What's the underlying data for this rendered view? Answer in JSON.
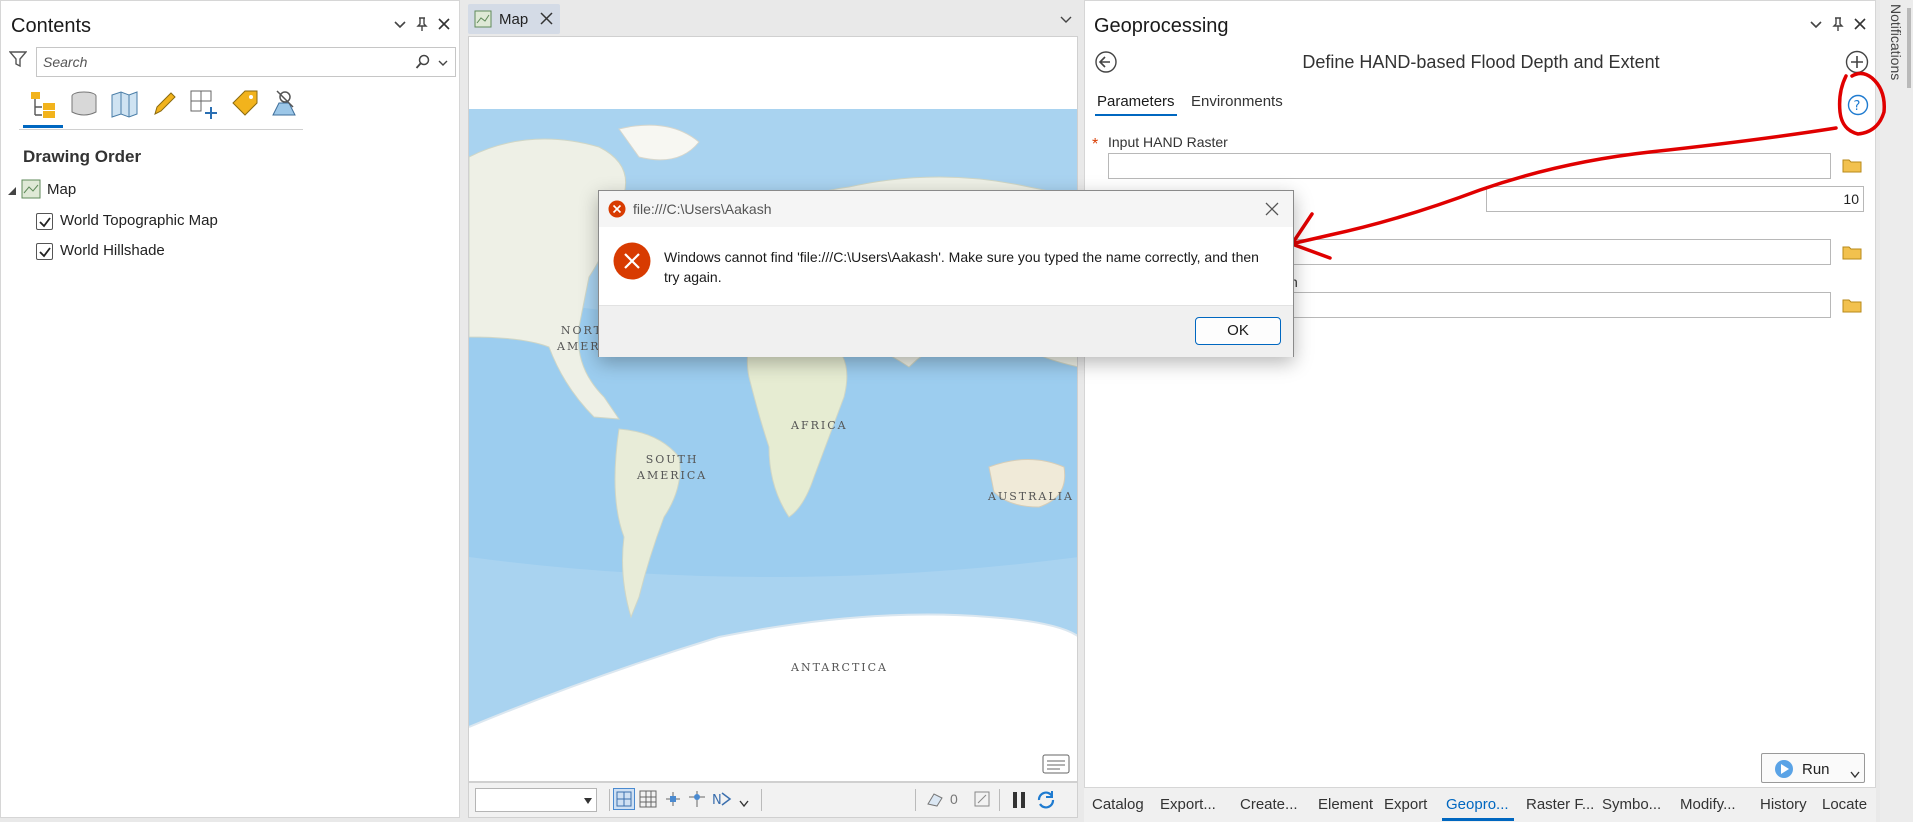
{
  "contents": {
    "title": "Contents",
    "search_placeholder": "Search",
    "section": "Drawing Order",
    "map_node": "Map",
    "layers": [
      {
        "label": "World Topographic Map",
        "checked": true
      },
      {
        "label": "World Hillshade",
        "checked": true
      }
    ]
  },
  "map_view": {
    "tab_label": "Map",
    "labels": {
      "north_america": [
        "NORT",
        "AMERI"
      ],
      "south_america": [
        "SOUTH",
        "AMERICA"
      ],
      "africa": "AFRICA",
      "australia": "AUSTRALIA",
      "antarctica": "ANTARCTICA"
    },
    "selection_count": "0"
  },
  "geoprocessing": {
    "title": "Geoprocessing",
    "tool_title": "Define HAND-based Flood Depth and Extent",
    "tabs": [
      "Parameters",
      "Environments"
    ],
    "active_tab": "Parameters",
    "required_marker": "*",
    "param1_label": "Input HAND Raster",
    "param2_value": "10",
    "param4_label_partial": "n",
    "run_label": "Run"
  },
  "bottom_tabs": [
    "Catalog",
    "Export...",
    "Create...",
    "Element",
    "Export",
    "Geopro...",
    "Raster F...",
    "Symbo...",
    "Modify...",
    "History",
    "Locate"
  ],
  "active_bottom_tab": "Geopro...",
  "notifications_label": "Notifications",
  "dialog": {
    "title": "file:///C:\\Users\\Aakash",
    "message": "Windows cannot find 'file:///C:\\Users\\Aakash'. Make sure you typed the name correctly, and then try again.",
    "ok_label": "OK"
  },
  "colors": {
    "accent": "#0067c0",
    "error": "#d83b01",
    "annotation": "#e00000",
    "ocean": "#a9d3f0",
    "land": "#eef0e6"
  }
}
